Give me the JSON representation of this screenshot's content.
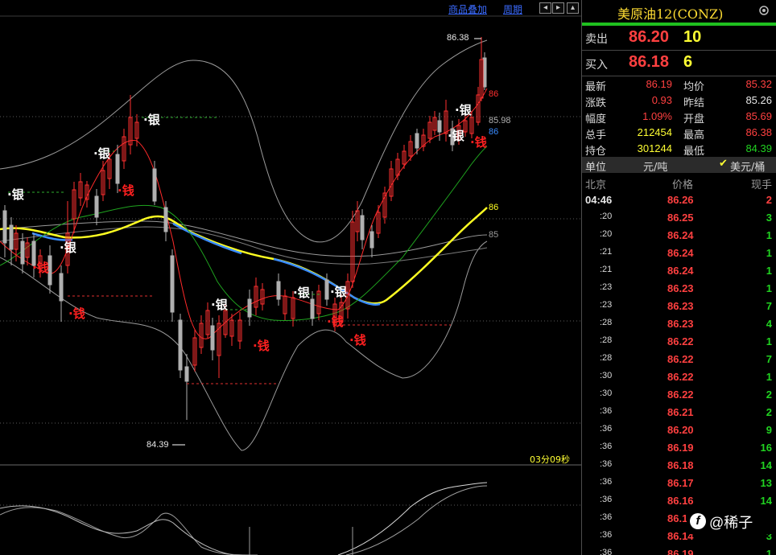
{
  "toolbar": {
    "overlay_label": "商品叠加",
    "period_label": "周期"
  },
  "chart": {
    "high_label": "86.38",
    "low_label": "84.39",
    "timer": "03分09秒",
    "axis_labels": {
      "red": "86",
      "blue_price": "85.98",
      "blue": "86",
      "yellow": "86",
      "gray": "85"
    },
    "signal_sell": "银",
    "signal_buy": "钱"
  },
  "quote": {
    "title": "美原油12(CONZ)",
    "sell_label": "卖出",
    "sell_price": "86.20",
    "sell_qty": "10",
    "buy_label": "买入",
    "buy_price": "86.18",
    "buy_qty": "6",
    "stats": [
      {
        "l1": "最新",
        "v1": "86.19",
        "l2": "均价",
        "v2": "85.32"
      },
      {
        "l1": "涨跌",
        "v1": "0.93",
        "l2": "昨结",
        "v2": "85.26"
      },
      {
        "l1": "幅度",
        "v1": "1.09%",
        "l2": "开盘",
        "v2": "85.69"
      },
      {
        "l1": "总手",
        "v1": "212454",
        "l2": "最高",
        "v2": "86.38"
      },
      {
        "l1": "持仓",
        "v1": "301244",
        "l2": "最低",
        "v2": "84.39"
      }
    ],
    "unit_label": "单位",
    "unit_value": "元/吨",
    "unit_option": "美元/桶",
    "col_city": "北京",
    "col_price": "价格",
    "col_qty": "现手",
    "ticks": [
      {
        "t": "04:46",
        "p": "86.26",
        "q": "2"
      },
      {
        "t": ":20",
        "p": "86.25",
        "q": "3"
      },
      {
        "t": ":20",
        "p": "86.24",
        "q": "1"
      },
      {
        "t": ":21",
        "p": "86.24",
        "q": "1"
      },
      {
        "t": ":21",
        "p": "86.24",
        "q": "1"
      },
      {
        "t": ":23",
        "p": "86.23",
        "q": "1"
      },
      {
        "t": ":23",
        "p": "86.23",
        "q": "7"
      },
      {
        "t": ":28",
        "p": "86.23",
        "q": "4"
      },
      {
        "t": ":28",
        "p": "86.22",
        "q": "1"
      },
      {
        "t": ":28",
        "p": "86.22",
        "q": "7"
      },
      {
        "t": ":30",
        "p": "86.22",
        "q": "1"
      },
      {
        "t": ":30",
        "p": "86.22",
        "q": "2"
      },
      {
        "t": ":36",
        "p": "86.21",
        "q": "2"
      },
      {
        "t": ":36",
        "p": "86.20",
        "q": "9"
      },
      {
        "t": ":36",
        "p": "86.19",
        "q": "16"
      },
      {
        "t": ":36",
        "p": "86.18",
        "q": "14"
      },
      {
        "t": ":36",
        "p": "86.17",
        "q": "13"
      },
      {
        "t": ":36",
        "p": "86.16",
        "q": "14"
      },
      {
        "t": ":36",
        "p": "86.1",
        "q": "9"
      },
      {
        "t": ":36",
        "p": "86.14",
        "q": "3"
      },
      {
        "t": ":36",
        "p": "86.19",
        "q": "1"
      }
    ]
  },
  "watermark": {
    "text": "@稀子"
  }
}
